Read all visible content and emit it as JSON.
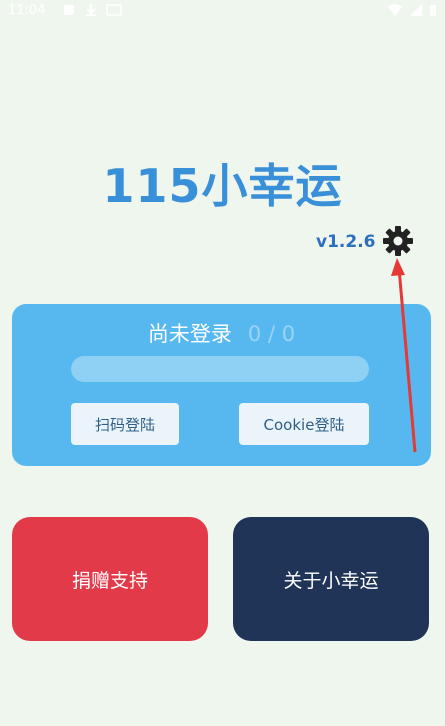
{
  "status_bar": {
    "time": "11:04"
  },
  "app": {
    "title": "115小幸运",
    "version": "v1.2.6"
  },
  "login_card": {
    "status": "尚未登录",
    "count": "0 / 0",
    "progress": 0,
    "scan_button": "扫码登陆",
    "cookie_button": "Cookie登陆"
  },
  "buttons": {
    "donate": "捐赠支持",
    "about": "关于小幸运"
  },
  "colors": {
    "background": "#eef6ee",
    "title": "#3a8fd9",
    "card": "#57b8f0",
    "donate": "#e23a48",
    "about": "#1f3456",
    "annotation_arrow": "#e53935"
  }
}
